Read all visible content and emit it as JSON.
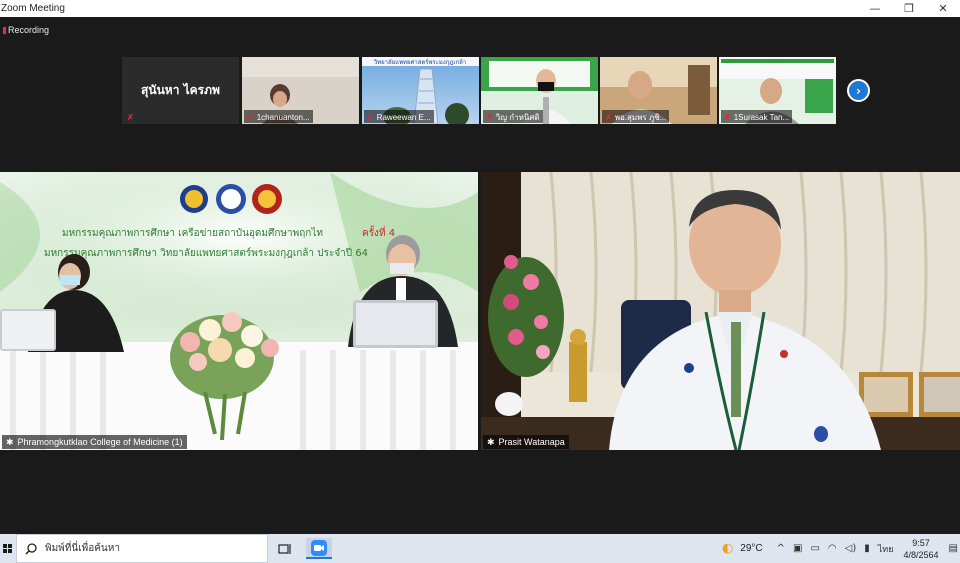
{
  "window": {
    "title": "Zoom Meeting",
    "minimize_glyph": "—",
    "restore_glyph": "❐",
    "close_glyph": "✕"
  },
  "meeting": {
    "recording_label": "Recording",
    "participants": [
      {
        "name": "สุนันหา ไครภพ",
        "video_off": true,
        "muted": true
      },
      {
        "name": "1chanuanton...",
        "muted": true
      },
      {
        "name": "Raweewan E...",
        "muted": true
      },
      {
        "name": "วิญ กำหนิศดิ",
        "muted": true
      },
      {
        "name": "พอ.สุมพร ภูชิ...",
        "muted": true
      },
      {
        "name": "1Surasak Tan...",
        "muted": true
      }
    ],
    "next_page_icon": "chevron-right-icon",
    "main_videos": [
      {
        "name": "Phramongkutklao College of Medicine (1)",
        "banner_line1": "มหกรรมคุณภาพการศึกษา เครือข่ายสถาบันอุดมศึกษาพฤกไท",
        "banner_line1_suffix": "ครั้งที่ 4",
        "banner_line2": "มหกรรมคุณภาพการศึกษา วิทยาลัยแพทยศาสตร์พระมงกุฎเกล้า ประจำปี 64"
      },
      {
        "name": "Prasit Watanapa"
      }
    ],
    "thumb_banner_raweewan": "วิทยาลัยแพทยศาสตร์พระมงกุฎเกล้า"
  },
  "taskbar": {
    "search_placeholder": "พิมพ์ที่นี่เพื่อค้นหา",
    "weather_temp": "29°C",
    "language": "ไทย",
    "time": "9:57",
    "date": "4/8/2564"
  },
  "colors": {
    "zoom_blue": "#1e78d7",
    "banner_green": "#2f9a3a",
    "banner_red": "#d2232a"
  }
}
